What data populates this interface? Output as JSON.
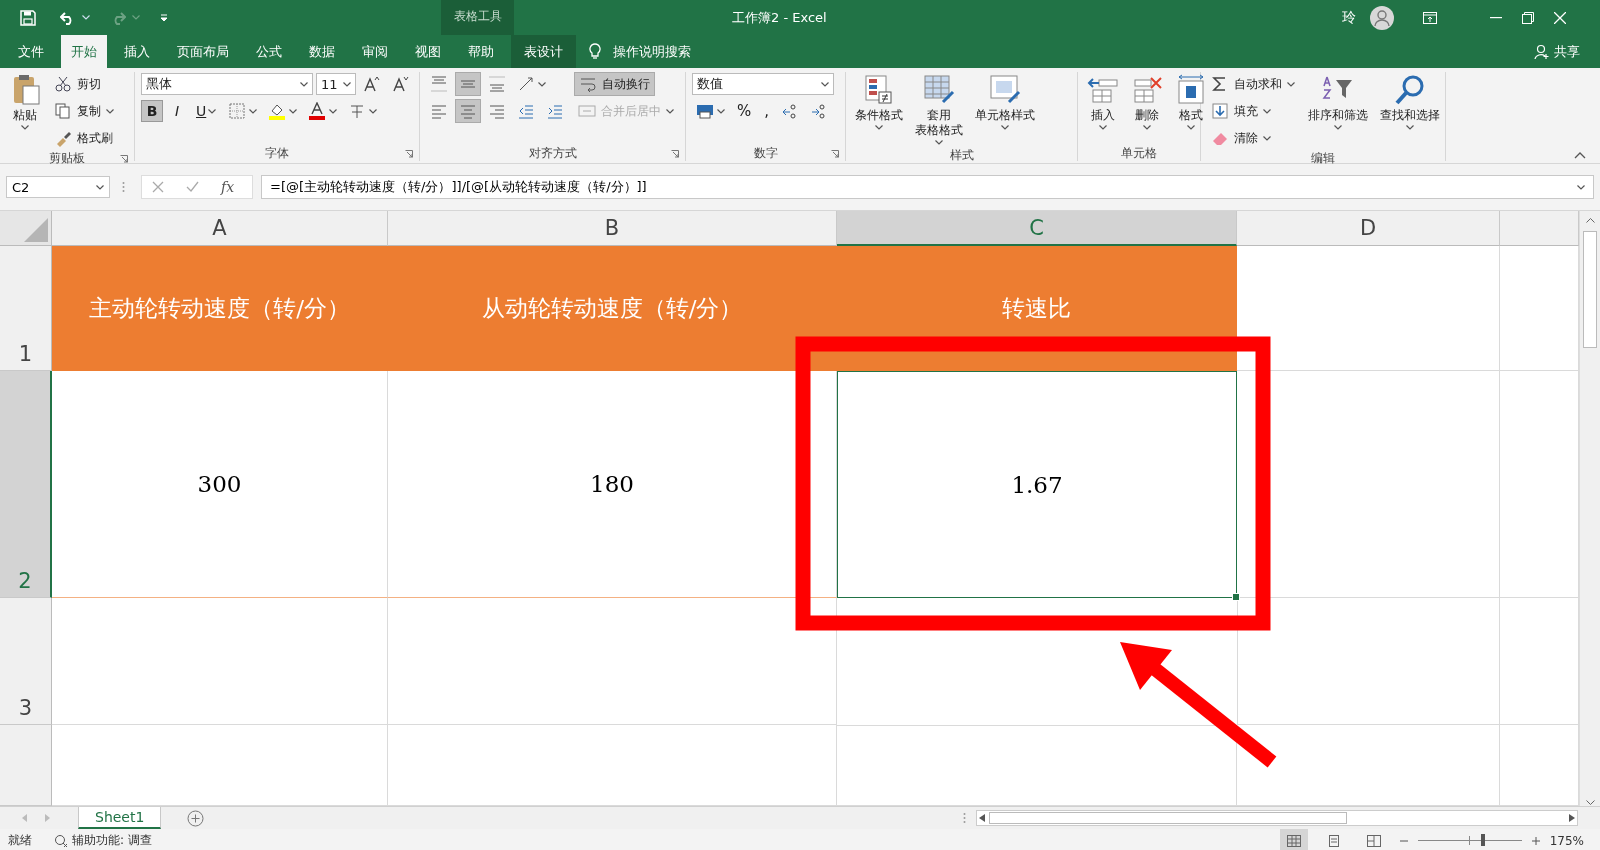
{
  "title_bar": {
    "context_label": "表格工具",
    "title": "工作簿2 - Excel",
    "user": "玲"
  },
  "tabs": [
    {
      "label": "文件",
      "selected": false,
      "kind": "file"
    },
    {
      "label": "开始",
      "selected": true,
      "kind": "normal"
    },
    {
      "label": "插入",
      "selected": false,
      "kind": "normal"
    },
    {
      "label": "页面布局",
      "selected": false,
      "kind": "normal"
    },
    {
      "label": "公式",
      "selected": false,
      "kind": "normal"
    },
    {
      "label": "数据",
      "selected": false,
      "kind": "normal"
    },
    {
      "label": "审阅",
      "selected": false,
      "kind": "normal"
    },
    {
      "label": "视图",
      "selected": false,
      "kind": "normal"
    },
    {
      "label": "帮助",
      "selected": false,
      "kind": "normal"
    },
    {
      "label": "表设计",
      "selected": false,
      "kind": "context"
    }
  ],
  "tell_me": "操作说明搜索",
  "share": "共享",
  "ribbon": {
    "groups": [
      {
        "title": "剪贴板",
        "launcher": true,
        "columns": [
          {
            "kind": "large",
            "label": "粘贴",
            "caret": true
          },
          {
            "kind": "stack",
            "rows": [
              [
                {
                  "kind": "small",
                  "label": "剪切"
                }
              ],
              [
                {
                  "kind": "small",
                  "label": "复制",
                  "caret": true
                }
              ],
              [
                {
                  "kind": "small",
                  "label": "格式刷"
                }
              ]
            ]
          }
        ]
      },
      {
        "title": "字体",
        "launcher": true,
        "columns": [
          {
            "kind": "stack",
            "rows": [
              [
                {
                  "kind": "field",
                  "value": "黑体"
                },
                {
                  "kind": "field",
                  "value": "11"
                },
                {
                  "kind": "icon"
                },
                {
                  "kind": "icon"
                }
              ],
              [
                {
                  "kind": "toggle",
                  "label": "B",
                  "selected": true
                },
                {
                  "kind": "toggle",
                  "label": "I",
                  "selected": false
                },
                {
                  "kind": "toggle",
                  "label": "U",
                  "selected": false,
                  "caret": true
                },
                {
                  "kind": "icon",
                  "caret": true
                },
                {
                  "kind": "icon",
                  "caret": true
                },
                {
                  "kind": "icon",
                  "caret": true
                },
                {
                  "kind": "icon",
                  "caret": true
                }
              ]
            ]
          }
        ]
      },
      {
        "title": "对齐方式",
        "launcher": true,
        "columns": [
          {
            "kind": "stack",
            "rows": [
              [
                {
                  "kind": "icon",
                  "selected": false
                },
                {
                  "kind": "icon",
                  "selected": true
                },
                {
                  "kind": "icon",
                  "selected": false
                },
                {
                  "kind": "icon",
                  "caret": true
                }
              ],
              [
                {
                  "kind": "icon",
                  "selected": false
                },
                {
                  "kind": "icon",
                  "selected": true
                },
                {
                  "kind": "icon",
                  "selected": false
                },
                {
                  "kind": "icon"
                },
                {
                  "kind": "icon"
                }
              ]
            ]
          },
          {
            "kind": "stack",
            "rows": [
              [
                {
                  "kind": "small",
                  "label": "自动换行",
                  "selected": true
                }
              ],
              [
                {
                  "kind": "small",
                  "label": "合并后居中",
                  "disabled": true,
                  "caret": true
                }
              ]
            ]
          }
        ]
      },
      {
        "title": "数字",
        "launcher": true,
        "columns": [
          {
            "kind": "stack",
            "rows": [
              [
                {
                  "kind": "field",
                  "value": "数值"
                }
              ],
              [
                {
                  "kind": "icon",
                  "caret": true
                },
                {
                  "kind": "glyph",
                  "label": "%"
                },
                {
                  "kind": "glyph",
                  "label": ","
                },
                {
                  "kind": "icon"
                },
                {
                  "kind": "icon"
                }
              ]
            ]
          }
        ]
      },
      {
        "title": "样式",
        "columns": [
          {
            "kind": "large",
            "label": "条件格式",
            "caret": true
          },
          {
            "kind": "large",
            "label_lines": [
              "套用",
              "表格格式"
            ],
            "caret": true
          },
          {
            "kind": "large",
            "label": "单元格样式",
            "caret": true
          }
        ]
      },
      {
        "title": "单元格",
        "columns": [
          {
            "kind": "large",
            "label": "插入",
            "caret": true
          },
          {
            "kind": "large",
            "label": "删除",
            "caret": true
          },
          {
            "kind": "large",
            "label": "格式",
            "caret": true
          }
        ]
      },
      {
        "title": "编辑",
        "columns": [
          {
            "kind": "stack",
            "rows": [
              [
                {
                  "kind": "small",
                  "label": "自动求和",
                  "caret": true
                }
              ],
              [
                {
                  "kind": "small",
                  "label": "填充",
                  "caret": true
                }
              ],
              [
                {
                  "kind": "small",
                  "label": "清除",
                  "caret": true
                }
              ]
            ]
          },
          {
            "kind": "large",
            "label": "排序和筛选",
            "caret": true
          },
          {
            "kind": "large",
            "label": "查找和选择",
            "caret": true
          }
        ]
      }
    ]
  },
  "formula_bar": {
    "name_box": "C2",
    "function_label": "fx",
    "formula": "=[@[主动轮转动速度（转/分）]]/[@[从动轮转动速度（转/分）]]"
  },
  "sheet": {
    "columns": [
      {
        "label": "A",
        "selected": false
      },
      {
        "label": "B",
        "selected": false
      },
      {
        "label": "C",
        "selected": true
      },
      {
        "label": "D",
        "selected": false
      }
    ],
    "rows": [
      {
        "number": "1",
        "selected": false,
        "kind": "header",
        "cells": [
          "主动轮转动速度（转/分）",
          "从动轮转动速度（转/分）",
          "转速比"
        ]
      },
      {
        "number": "2",
        "selected": true,
        "kind": "data",
        "cells": [
          "300",
          "180",
          "1.67"
        ]
      },
      {
        "number": "3",
        "selected": false,
        "kind": "data"
      }
    ]
  },
  "sheet_tabs": [
    {
      "label": "Sheet1",
      "selected": true
    }
  ],
  "status_bar": {
    "status": "就绪",
    "accessibility": "辅助功能: 调查",
    "zoom": "175%",
    "zoom_slider": {
      "level": 0.63
    },
    "views": [
      {
        "selected": true
      },
      {
        "selected": false
      },
      {
        "selected": false
      }
    ]
  }
}
